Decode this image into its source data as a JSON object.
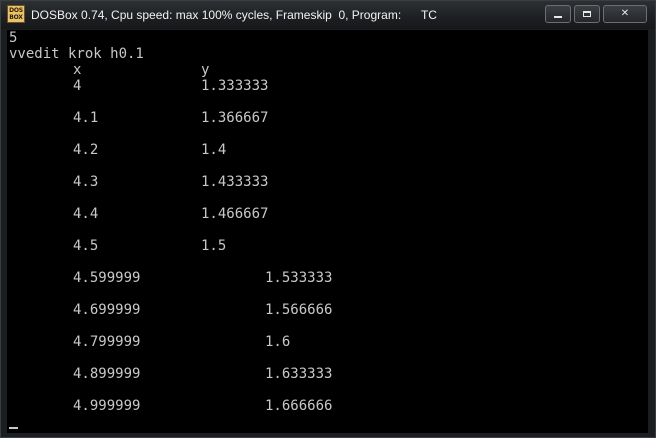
{
  "window": {
    "title": "DOSBox 0.74, Cpu speed: max 100% cycles, Frameskip  0, Program:      TC",
    "icon_label_top": "DOS",
    "icon_label_bottom": "BOX"
  },
  "caption_buttons": {
    "minimize_icon": "minimize-icon",
    "maximize_icon": "maximize-icon",
    "close_icon": "close-icon",
    "close_glyph": "✕"
  },
  "console": {
    "input_value": "5",
    "prompt_line": "vvedit krok h0.1",
    "header_x": "x",
    "header_y": "y",
    "rows": [
      {
        "x": "4",
        "y": "1.333333"
      },
      {
        "x": "4.1",
        "y": "1.366667"
      },
      {
        "x": "4.2",
        "y": "1.4"
      },
      {
        "x": "4.3",
        "y": "1.433333"
      },
      {
        "x": "4.4",
        "y": "1.466667"
      },
      {
        "x": "4.5",
        "y": "1.5"
      },
      {
        "x": "4.599999",
        "y": "1.533333"
      },
      {
        "x": "4.699999",
        "y": "1.566666"
      },
      {
        "x": "4.799999",
        "y": "1.6"
      },
      {
        "x": "4.899999",
        "y": "1.633333"
      },
      {
        "x": "4.999999",
        "y": "1.666666"
      }
    ]
  }
}
